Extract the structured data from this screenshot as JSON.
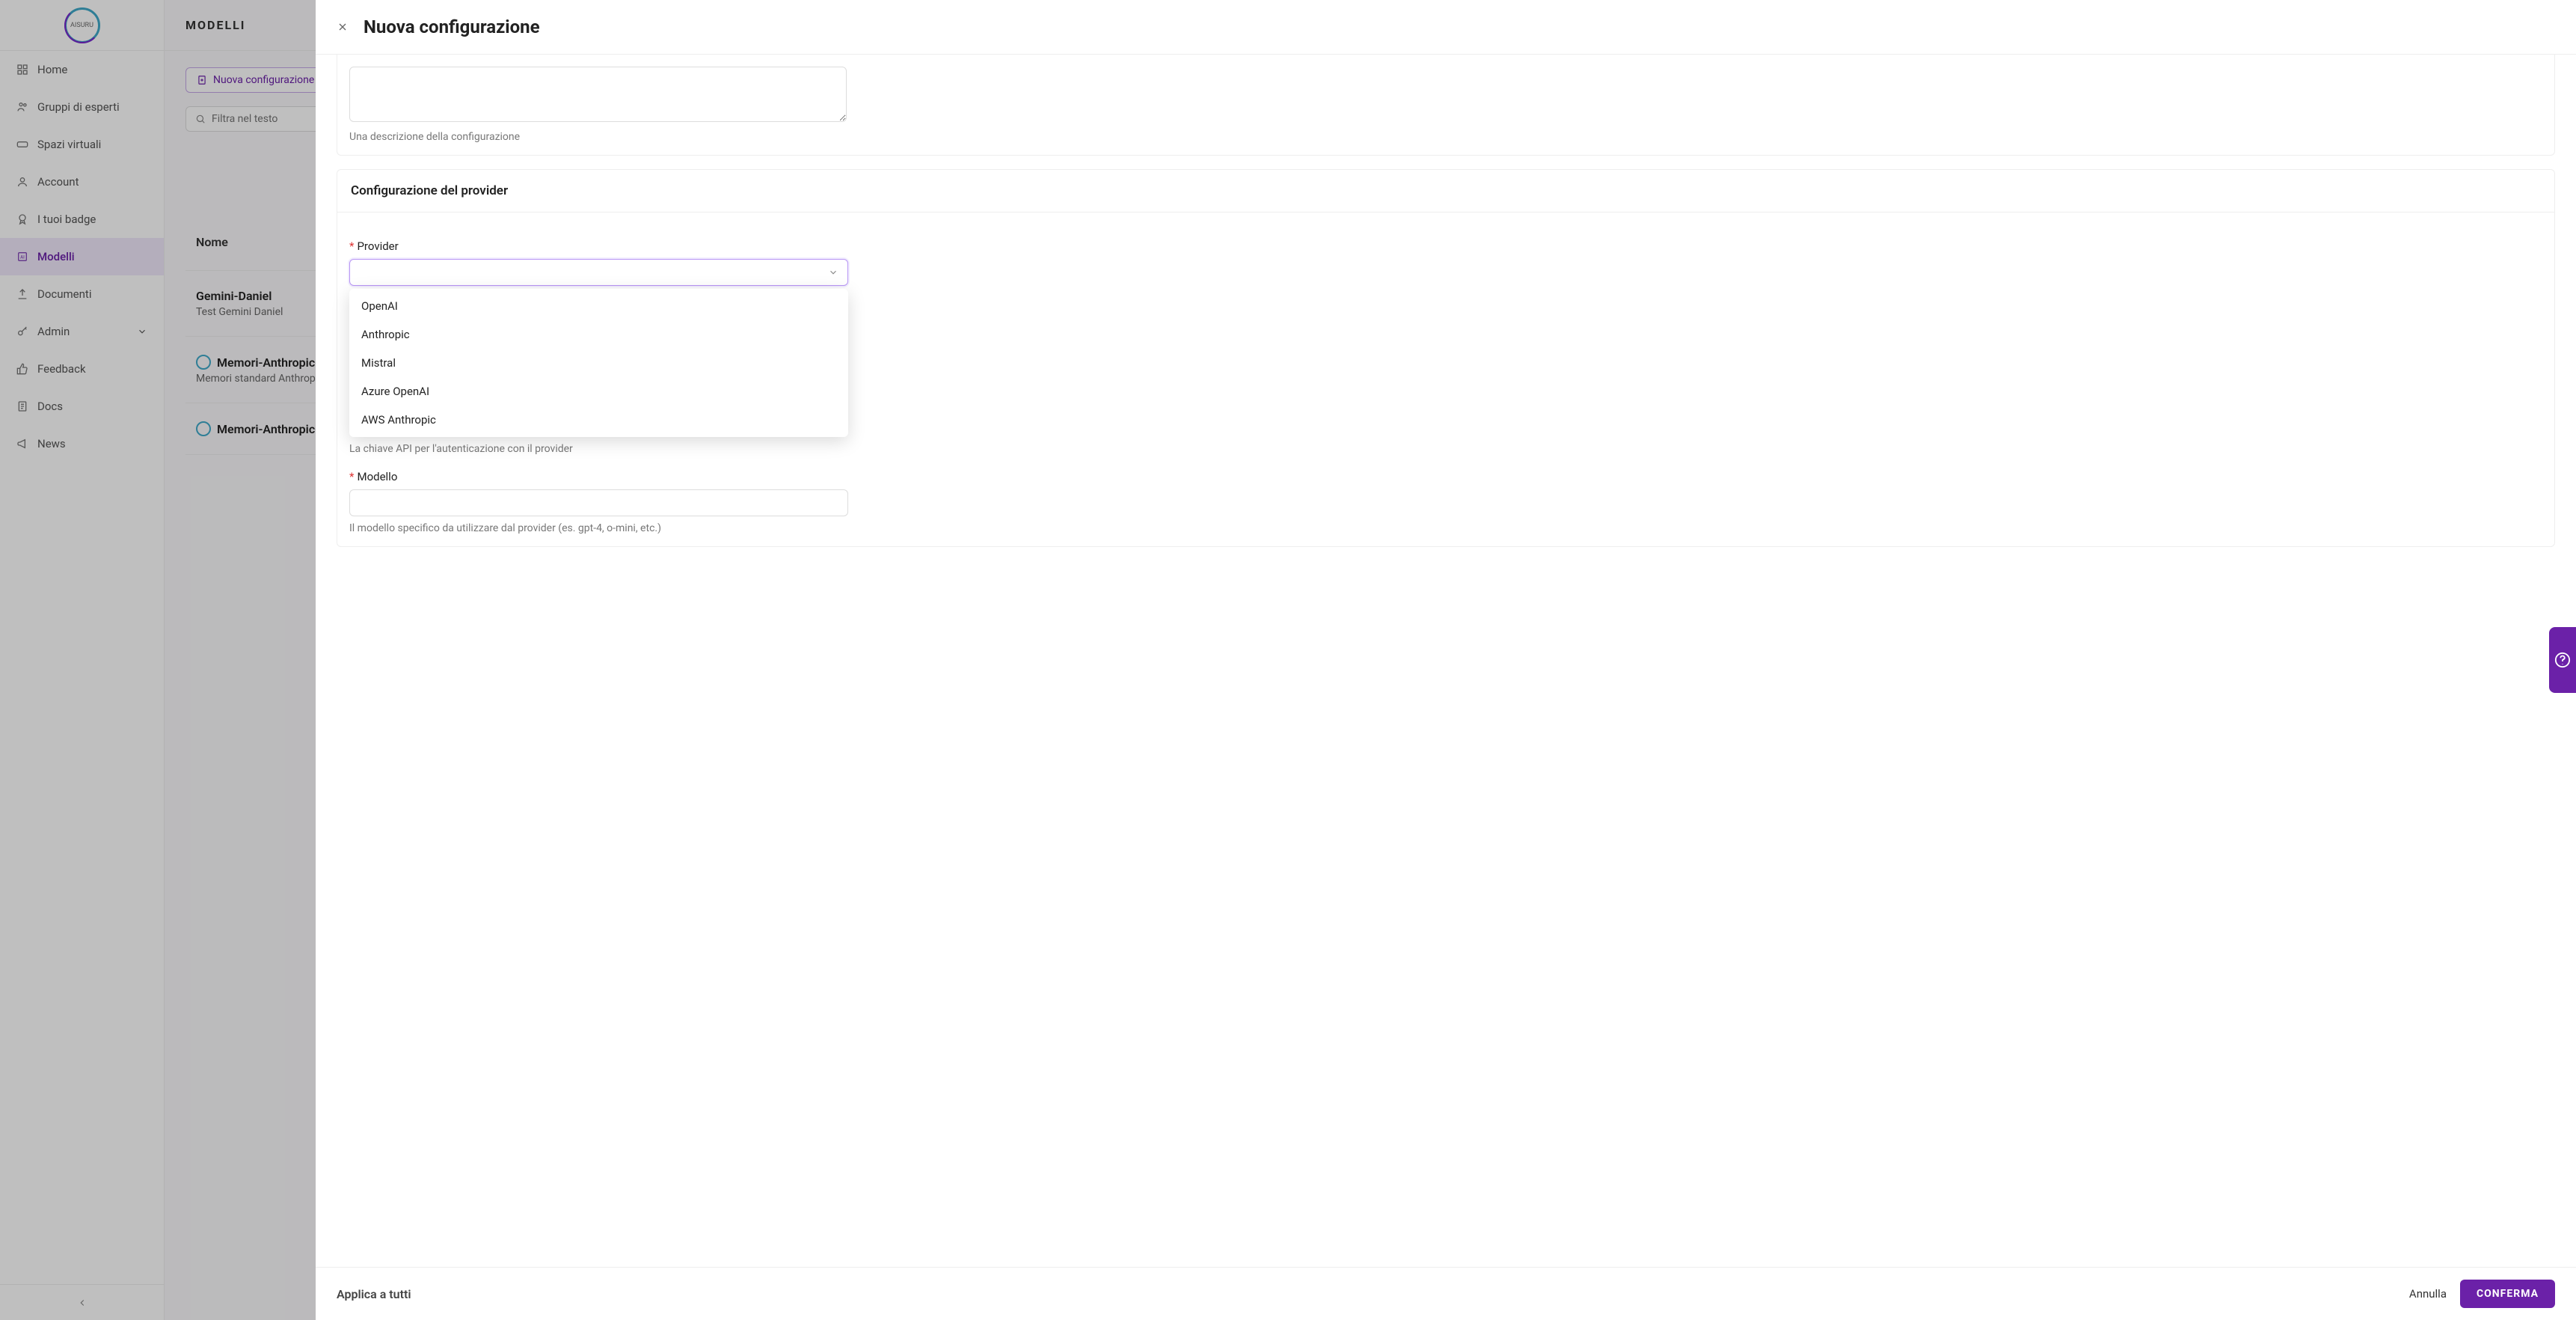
{
  "logo_text": "AISURU",
  "sidebar": {
    "items": [
      {
        "label": "Home",
        "icon": "home-icon"
      },
      {
        "label": "Gruppi di esperti",
        "icon": "group-icon"
      },
      {
        "label": "Spazi virtuali",
        "icon": "vr-icon"
      },
      {
        "label": "Account",
        "icon": "user-icon"
      },
      {
        "label": "I tuoi badge",
        "icon": "badge-icon"
      },
      {
        "label": "Modelli",
        "icon": "ai-icon"
      },
      {
        "label": "Documenti",
        "icon": "upload-icon"
      },
      {
        "label": "Admin",
        "icon": "key-icon"
      },
      {
        "label": "Feedback",
        "icon": "thumb-icon"
      },
      {
        "label": "Docs",
        "icon": "doc-icon"
      },
      {
        "label": "News",
        "icon": "megaphone-icon"
      }
    ],
    "active_index": 5
  },
  "page_title": "MODELLI",
  "toolbar": {
    "new_label": "Nuova configurazione"
  },
  "filter": {
    "placeholder": "Filtra nel testo"
  },
  "table": {
    "col_name": "Nome",
    "rows": [
      {
        "title": "Gemini-Daniel",
        "subtitle": "Test Gemini Daniel",
        "has_logo": false
      },
      {
        "title": "Memori-Anthropic-DeepThought",
        "subtitle": "Memori standard Anthropic configuration for Deep Thought",
        "has_logo": true
      },
      {
        "title": "Memori-Anthropic-ImportExport",
        "subtitle": "",
        "has_logo": true
      }
    ]
  },
  "modal": {
    "title": "Nuova configurazione",
    "desc_helper": "Una descrizione della configurazione",
    "provider_section_title": "Configurazione del provider",
    "provider_label": "Provider",
    "provider_options": [
      "OpenAI",
      "Anthropic",
      "Mistral",
      "Azure OpenAI",
      "AWS Anthropic"
    ],
    "apikey_helper": "La chiave API per l'autenticazione con il provider",
    "model_label": "Modello",
    "model_helper": "Il modello specifico da utilizzare dal provider (es. gpt-4, o-mini, etc.)",
    "apply_all_label": "Applica a tutti",
    "cancel_label": "Annulla",
    "confirm_label": "CONFERMA"
  }
}
